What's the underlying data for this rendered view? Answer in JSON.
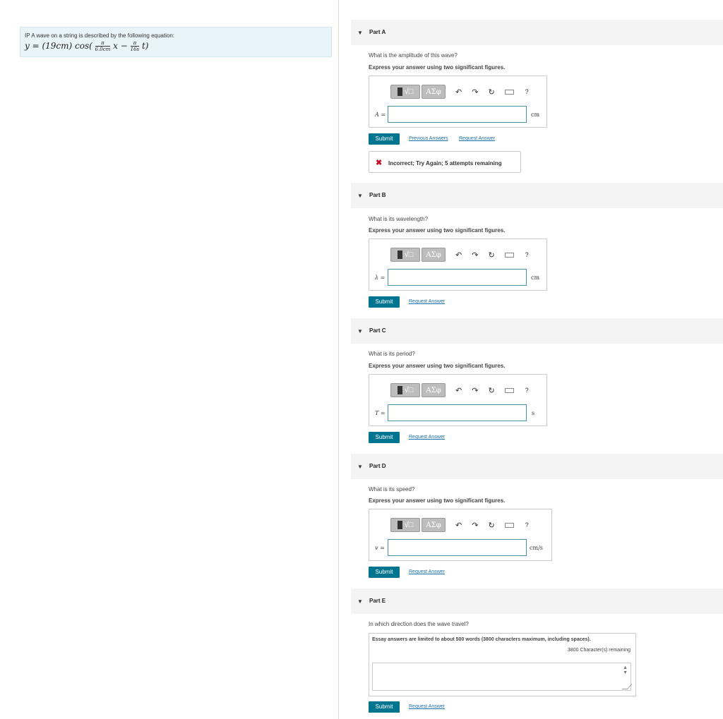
{
  "problem": {
    "intro": "IP A wave on a string is described by the following equation:",
    "eq_prefix": "y = (19cm) cos(",
    "frac1_num": "π",
    "frac1_den": "6.0cm",
    "eq_mid": "x −",
    "frac2_num": "π",
    "frac2_den": "16s",
    "eq_suffix": "t)"
  },
  "toolbar": {
    "templates_label": "√□",
    "symbols_label": "AΣφ",
    "undo_icon": "↶",
    "redo_icon": "↷",
    "reset_icon": "↻",
    "help_label": "?"
  },
  "submit_label": "Submit",
  "instruction": "Express your answer using two significant figures.",
  "request_answer": "Request Answer",
  "parts": {
    "a": {
      "title": "Part A",
      "question": "What is the amplitude of this wave?",
      "variable": "A =",
      "unit": "cm",
      "input_value": "",
      "previous_answers": "Previous Answers",
      "feedback": "Incorrect; Try Again; 5 attempts remaining",
      "feedback_icon": "✖"
    },
    "b": {
      "title": "Part B",
      "question": "What is its wavelength?",
      "variable": "λ =",
      "unit": "cm",
      "input_value": ""
    },
    "c": {
      "title": "Part C",
      "question": "What is its period?",
      "variable": "T =",
      "unit": "s",
      "input_value": ""
    },
    "d": {
      "title": "Part D",
      "question": "What is its speed?",
      "variable": "v =",
      "unit": "cm/s",
      "input_value": ""
    },
    "e": {
      "title": "Part E",
      "question": "In which direction does the wave travel?",
      "essay_limit": "Essay answers are limited to about 500 words (3800 characters maximum, including spaces).",
      "remaining": "3800 Character(s) remaining",
      "essay_value": ""
    }
  }
}
